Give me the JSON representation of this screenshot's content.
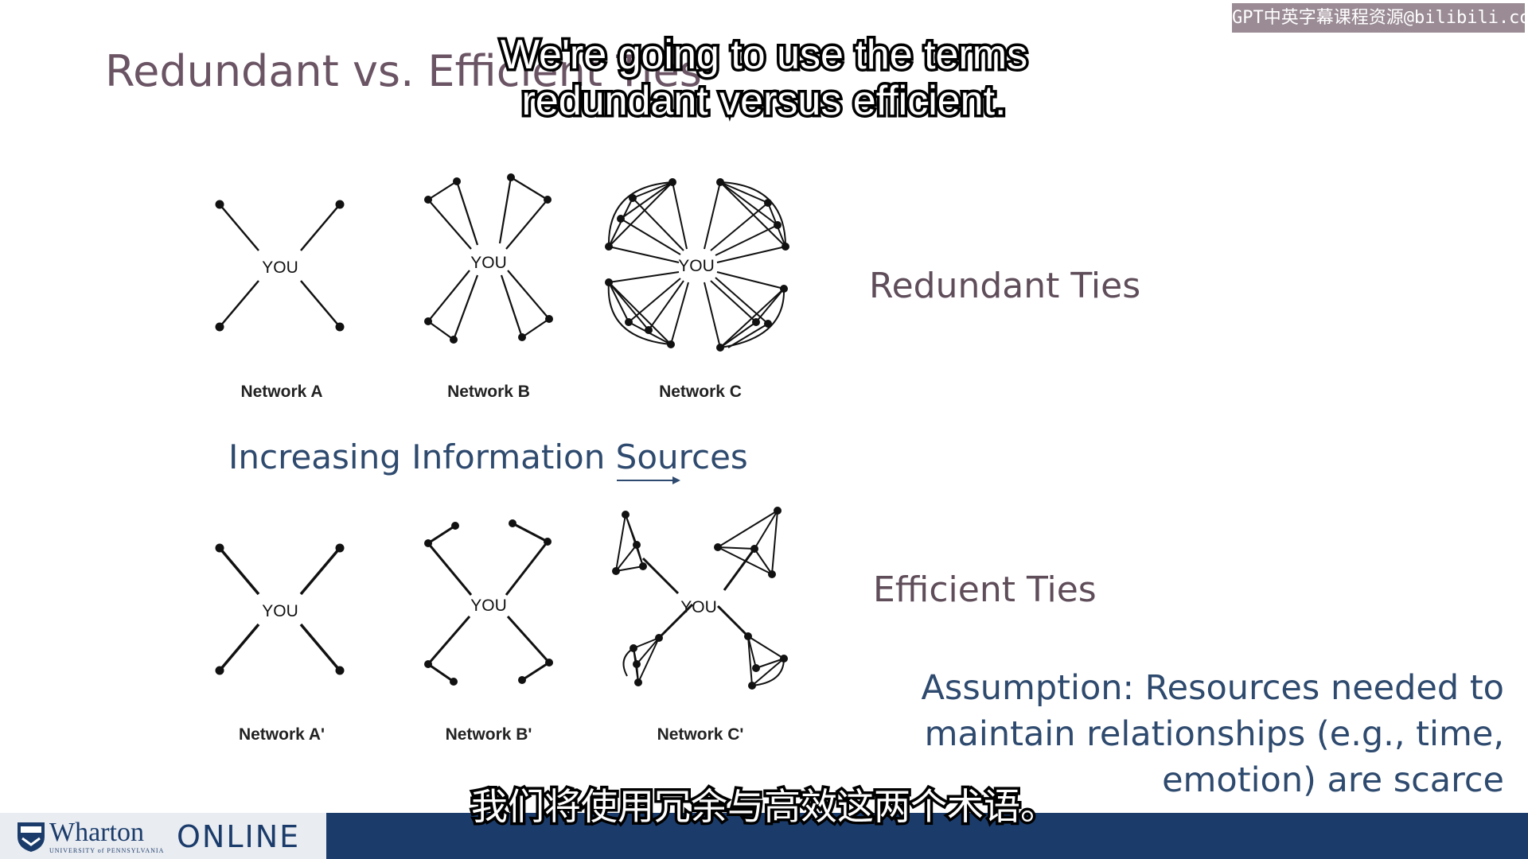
{
  "slide": {
    "title": "Redundant vs. Efficient Ties",
    "increasing_label": "Increasing Information Sources",
    "redundant_label": "Redundant Ties",
    "efficient_label": "Efficient Ties",
    "assumption_lines": [
      "Assumption: Resources needed to",
      "maintain relationships (e.g., time,",
      "emotion) are scarce"
    ]
  },
  "networks": {
    "center_label": "YOU",
    "top_labels": [
      "Network A",
      "Network B",
      "Network C"
    ],
    "bottom_labels": [
      "Network A'",
      "Network B'",
      "Network C'"
    ]
  },
  "subtitles": {
    "english_lines": [
      "We're going to use the terms",
      "redundant versus efficient."
    ],
    "chinese": "我们将使用冗余与高效这两个术语。"
  },
  "watermark": "GPT中英字幕课程资源@bilibili.com",
  "footer": {
    "brand": "Wharton",
    "brand_sub": "UNIVERSITY of PENNSYLVANIA",
    "online": "ONLINE"
  },
  "icons": [
    "shield-icon",
    "arrow-right-icon"
  ],
  "colors": {
    "title": "#6b5565",
    "blue_text": "#2e4a6e",
    "footer_bg": "#1b3c6b",
    "watermark_bg": "#9a8b94"
  }
}
